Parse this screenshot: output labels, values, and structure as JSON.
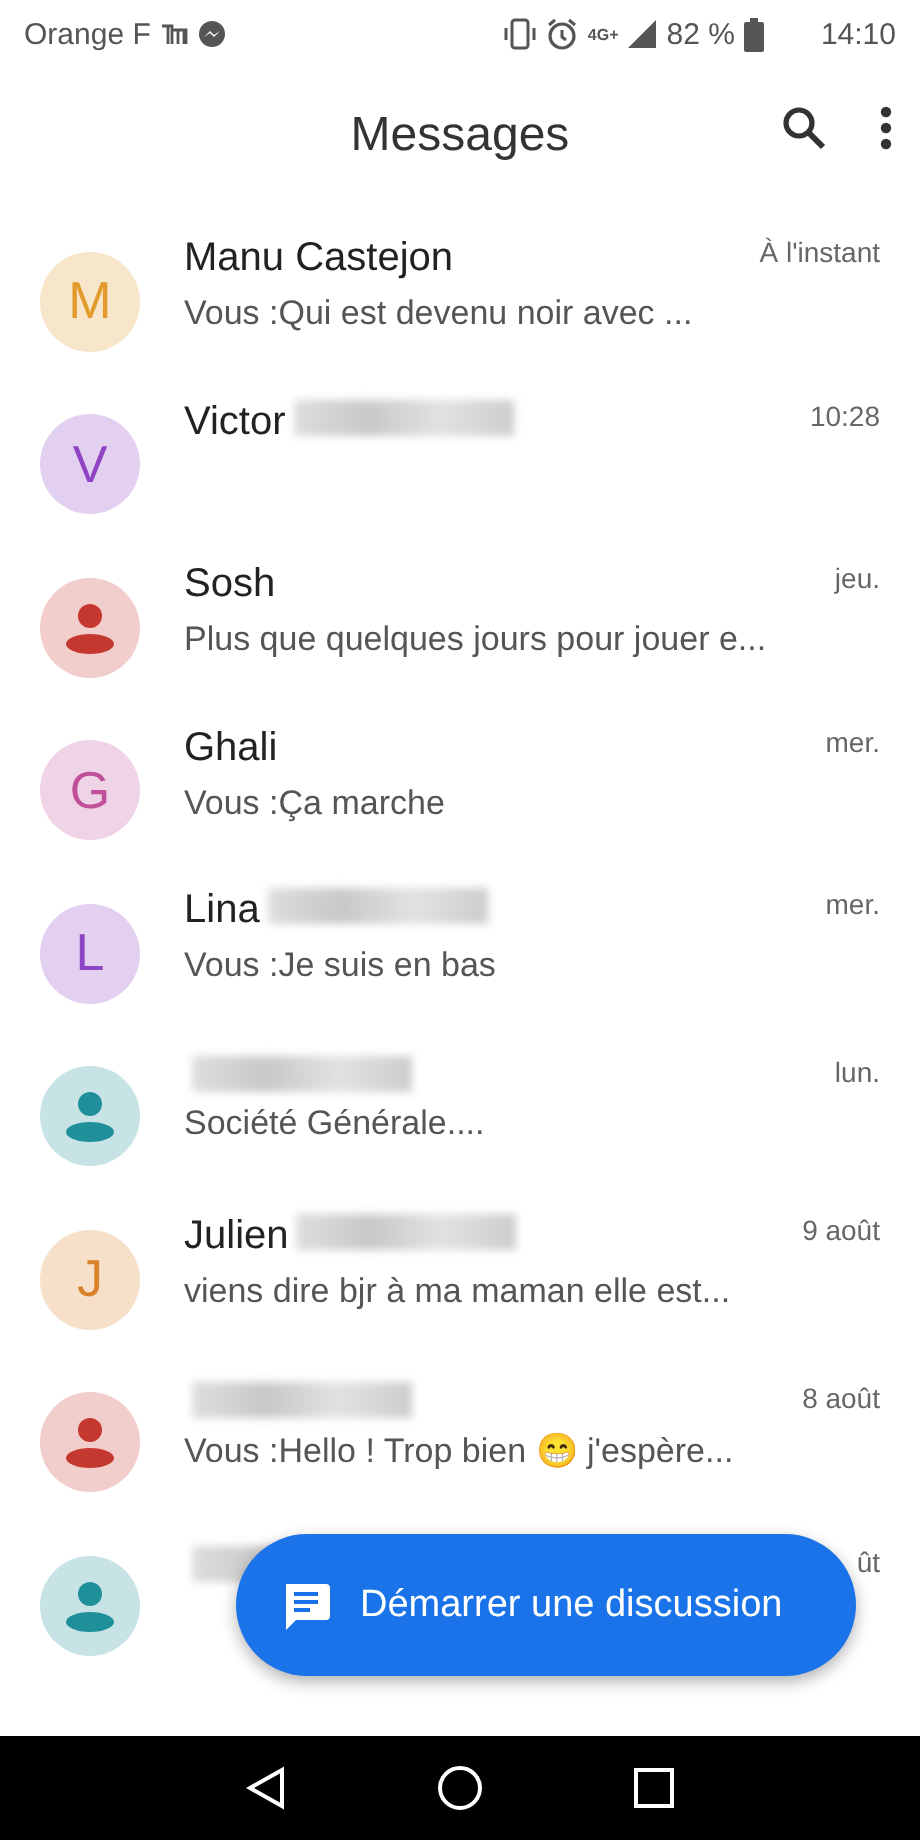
{
  "status_bar": {
    "carrier": "Orange F",
    "network": "4G+",
    "battery": "82 %",
    "time": "14:10"
  },
  "app_bar": {
    "title": "Messages"
  },
  "conversations": [
    {
      "avatar": {
        "kind": "letter",
        "letter": "M",
        "color": "#e39a2d"
      },
      "name": "Manu Castejon",
      "name_blurred": false,
      "time": "À l'instant",
      "preview": "Vous :Qui est devenu noir avec ..."
    },
    {
      "avatar": {
        "kind": "letter",
        "letter": "V",
        "color": "#8e44c4"
      },
      "name": "Victor",
      "name_blurred": true,
      "time": "10:28"
    },
    {
      "avatar": {
        "kind": "person",
        "color": "#c5382f"
      },
      "name": "Sosh",
      "name_blurred": false,
      "time": "jeu.",
      "preview": "Plus que quelques jours pour jouer e..."
    },
    {
      "avatar": {
        "kind": "letter",
        "letter": "G",
        "color": "#c0509a"
      },
      "name": "Ghali",
      "name_blurred": false,
      "time": "mer.",
      "preview": "Vous :Ça marche"
    },
    {
      "avatar": {
        "kind": "letter",
        "letter": "L",
        "color": "#8e44c4"
      },
      "name": "Lina",
      "name_blurred": true,
      "time": "mer.",
      "preview": "Vous :Je suis en bas"
    },
    {
      "avatar": {
        "kind": "person",
        "color": "#1f8f99"
      },
      "name_blurred": true,
      "time": "lun.",
      "preview": "Société Générale...."
    },
    {
      "avatar": {
        "kind": "letter",
        "letter": "J",
        "color": "#d9822b"
      },
      "name": "Julien",
      "name_blurred": true,
      "time": "9 août",
      "preview": "viens dire bjr à ma maman elle est..."
    },
    {
      "avatar": {
        "kind": "person",
        "color": "#c5382f"
      },
      "name_blurred": true,
      "time": "8 août",
      "preview": "Vous :Hello ! Trop bien 😁 j'espère..."
    },
    {
      "avatar": {
        "kind": "person",
        "color": "#1f8f99"
      },
      "name_blurred": true,
      "time": "ût"
    }
  ],
  "fab": {
    "label": "Démarrer une discussion"
  }
}
